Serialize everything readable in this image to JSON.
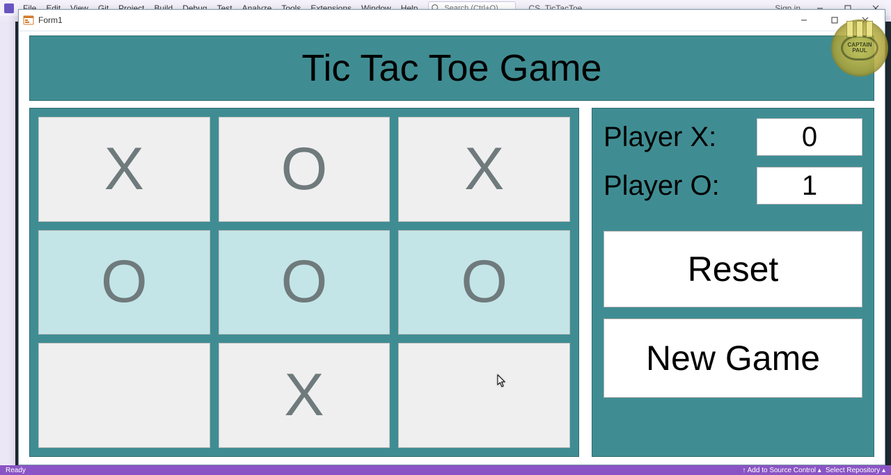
{
  "vs": {
    "menus": [
      "File",
      "Edit",
      "View",
      "Git",
      "Project",
      "Build",
      "Debug",
      "Test",
      "Analyze",
      "Tools",
      "Extensions",
      "Window",
      "Help"
    ],
    "search_placeholder": "Search (Ctrl+Q)",
    "solution_name": "CS_TicTacToe",
    "sign_in": "Sign in",
    "status_ready": "Ready",
    "status_add_source": "↑ Add to Source Control ▴",
    "status_select_repo": "Select Repository ▴"
  },
  "form": {
    "title": "Form1"
  },
  "game": {
    "title": "Tic Tac Toe Game",
    "board": [
      {
        "v": "X",
        "win": false
      },
      {
        "v": "O",
        "win": false
      },
      {
        "v": "X",
        "win": false
      },
      {
        "v": "O",
        "win": true
      },
      {
        "v": "O",
        "win": true
      },
      {
        "v": "O",
        "win": true
      },
      {
        "v": "",
        "win": false
      },
      {
        "v": "X",
        "win": false
      },
      {
        "v": "",
        "win": false
      }
    ],
    "score": {
      "x_label": "Player X:",
      "x_value": "0",
      "o_label": "Player O:",
      "o_value": "1"
    },
    "buttons": {
      "reset": "Reset",
      "new_game": "New Game"
    }
  },
  "badge": {
    "text": "CAPTAIN PAUL"
  }
}
